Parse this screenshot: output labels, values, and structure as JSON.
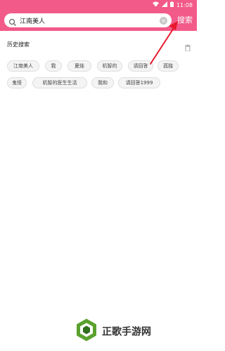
{
  "status_bar": {
    "time": "11:08"
  },
  "search": {
    "value": "江南美人",
    "button_label": "搜索"
  },
  "history": {
    "title": "历史搜索",
    "chips": [
      "江南美人",
      "我",
      "夏娃",
      "机智的",
      "请回答",
      "孤独",
      "鬼怪",
      "机智的医生生活",
      "我和",
      "请回答1999"
    ]
  },
  "watermark": {
    "text": "正歌手游网"
  },
  "colors": {
    "accent": "#f25a8a",
    "arrow": "#e8192c"
  }
}
